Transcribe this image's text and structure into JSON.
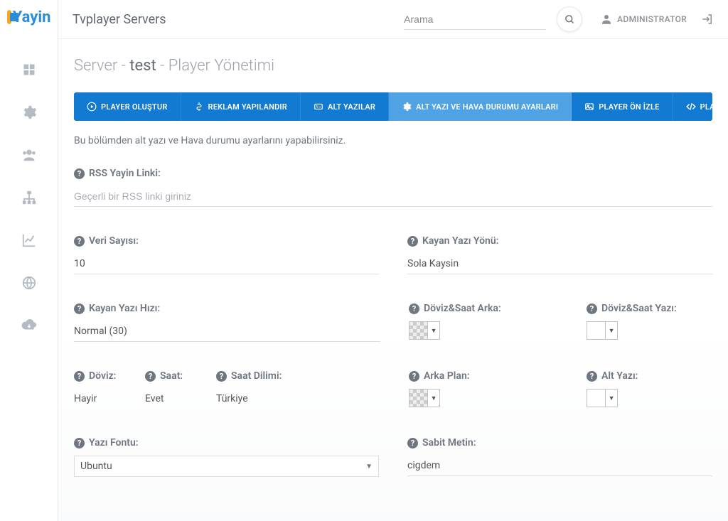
{
  "app_name": "Yayin",
  "header": {
    "title": "Tvplayer Servers",
    "search_placeholder": "Arama",
    "user_label": "ADMINISTRATOR"
  },
  "page": {
    "title_prefix": "Server - ",
    "title_server": "test",
    "title_suffix": " - Player Yönetimi"
  },
  "tabs": [
    "PLAYER OLUŞTUR",
    "REKLAM YAPILANDIR",
    "ALT YAZILAR",
    "ALT YAZI VE HAVA DURUMU AYARLARI",
    "PLAYER ÖN İZLE",
    "PLAYER KODU"
  ],
  "active_tab": 3,
  "description": "Bu bölümden alt yazı ve Hava durumu ayarlarını yapabilirsiniz.",
  "fields": {
    "rss_label": "RSS Yayin Linki:",
    "rss_placeholder": "Geçerli bir RSS linki giriniz",
    "rss_value": "",
    "veri_sayisi_label": "Veri Sayısı:",
    "veri_sayisi_value": "10",
    "kayan_yazi_yonu_label": "Kayan Yazı Yönü:",
    "kayan_yazi_yonu_value": "Sola Kaysin",
    "kayan_yazi_hizi_label": "Kayan Yazı Hızı:",
    "kayan_yazi_hizi_value": "Normal (30)",
    "doviz_saat_arka_label": "Döviz&Saat Arka:",
    "doviz_saat_yazi_label": "Döviz&Saat Yazı:",
    "doviz_label": "Döviz:",
    "doviz_value": "Hayir",
    "saat_label": "Saat:",
    "saat_value": "Evet",
    "saat_dilimi_label": "Saat Dilimi:",
    "saat_dilimi_value": "Türkiye",
    "arka_plan_label": "Arka Plan:",
    "alt_yazi_label": "Alt Yazı:",
    "yazi_fontu_label": "Yazı Fontu:",
    "yazi_fontu_value": "Ubuntu",
    "sabit_metin_label": "Sabit Metin:",
    "sabit_metin_value": "cigdem"
  },
  "colors": {
    "doviz_saat_arka": "transparent",
    "doviz_saat_yazi": "#ffffff",
    "arka_plan": "transparent",
    "alt_yazi": "#ffffff"
  }
}
